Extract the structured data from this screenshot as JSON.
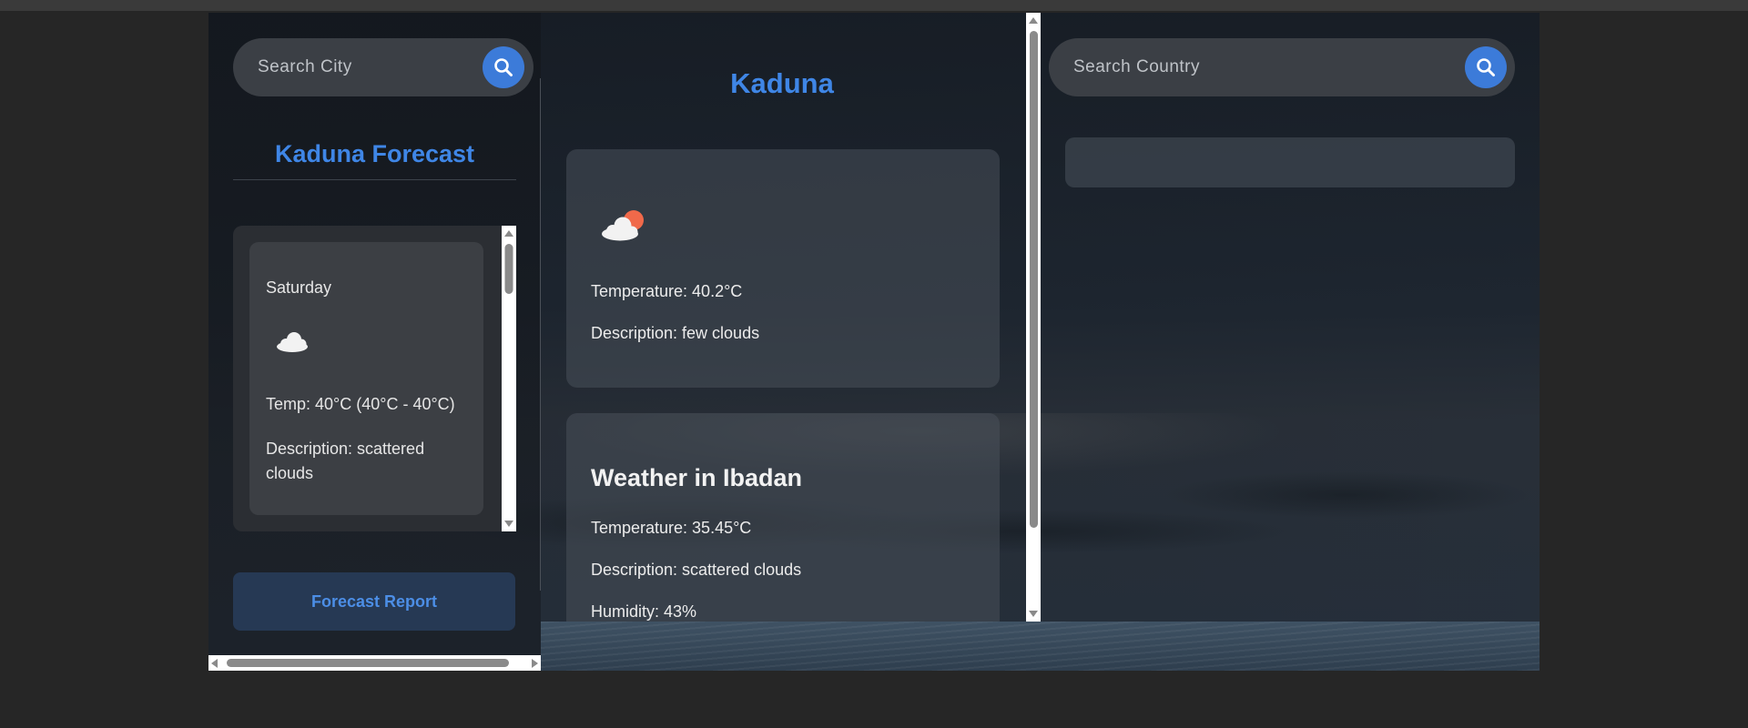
{
  "city_search": {
    "placeholder": "Search City"
  },
  "country_search": {
    "placeholder": "Search Country"
  },
  "forecast": {
    "title": "Kaduna Forecast",
    "day": "Saturday",
    "icon": "cloud-icon",
    "temp": "Temp: 40°C (40°C - 40°C)",
    "description": "Description: scattered clouds",
    "report_button": "Forecast Report"
  },
  "current": {
    "city": "Kaduna",
    "icon": "few-clouds-icon",
    "temperature": "Temperature: 40.2°C",
    "description": "Description: few clouds"
  },
  "ibadan": {
    "heading": "Weather in Ibadan",
    "temperature": "Temperature: 35.45°C",
    "description": "Description: scattered clouds",
    "humidity": "Humidity: 43%"
  },
  "colors": {
    "accent": "#3f86e6",
    "button": "#3c7bd9",
    "page_background": "#262626"
  }
}
